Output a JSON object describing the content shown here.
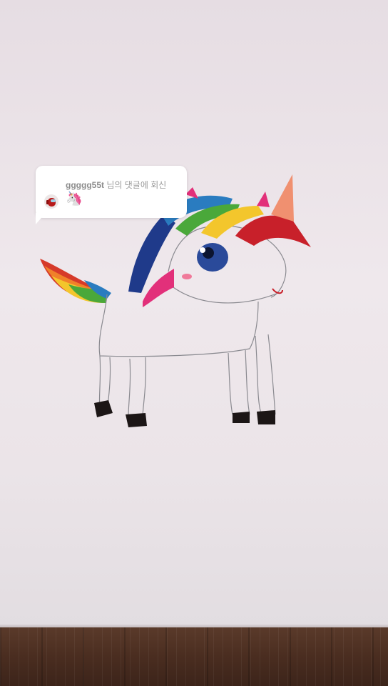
{
  "reply_bubble": {
    "username": "ggggg55t",
    "suffix": "님의 댓글에 회신",
    "comment": "🦄"
  },
  "colors": {
    "paper": "#ece4e9",
    "table": "#4a2d20",
    "bubble": "#ffffff"
  },
  "icons": {
    "avatar": "among-us-crewmate-icon"
  }
}
